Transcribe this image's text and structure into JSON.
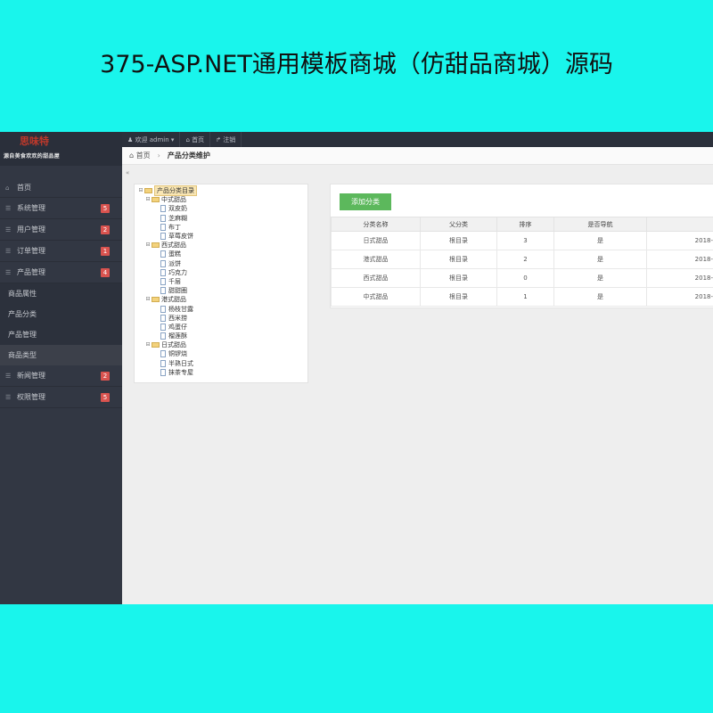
{
  "banner": {
    "title": "375-ASP.NET通用模板商城（仿甜品商城）源码"
  },
  "logo": {
    "name": "思味特",
    "slogan": "源自美食欢欢的甜品屋"
  },
  "topbar": {
    "welcome": "欢迎 admin",
    "home": "首页",
    "logout": "注销"
  },
  "sidebar": {
    "home": "首页",
    "items": [
      {
        "label": "系统管理",
        "badge": "5"
      },
      {
        "label": "用户管理",
        "badge": "2"
      },
      {
        "label": "订单管理",
        "badge": "1"
      },
      {
        "label": "产品管理",
        "badge": "4"
      }
    ],
    "subitems": [
      "商品属性",
      "产品分类",
      "产品管理",
      "商品类型"
    ],
    "items2": [
      {
        "label": "新闻管理",
        "badge": "2"
      },
      {
        "label": "权限管理",
        "badge": "5"
      }
    ]
  },
  "breadcrumb": {
    "home": "首页",
    "current": "产品分类维护"
  },
  "tree": {
    "root": "产品分类目录",
    "groups": [
      {
        "name": "中式甜品",
        "children": [
          "双皮奶",
          "芝麻糊",
          "布丁",
          "草莓皮饼"
        ]
      },
      {
        "name": "西式甜品",
        "children": [
          "蛋糕",
          "派饼",
          "巧克力",
          "千层",
          "甜甜圈"
        ]
      },
      {
        "name": "港式甜品",
        "children": [
          "杨枝甘露",
          "西米捞",
          "鸡蛋仔",
          "榴莲酥"
        ]
      },
      {
        "name": "日式甜品",
        "children": [
          "铜锣烧",
          "半熟日式",
          "抹茶专屋"
        ]
      }
    ]
  },
  "table": {
    "add_button": "添加分类",
    "headers": [
      "分类名称",
      "父分类",
      "排序",
      "是否导航",
      ""
    ],
    "rows": [
      [
        "日式甜品",
        "根目录",
        "3",
        "是",
        "2018-"
      ],
      [
        "港式甜品",
        "根目录",
        "2",
        "是",
        "2018-"
      ],
      [
        "西式甜品",
        "根目录",
        "0",
        "是",
        "2018-"
      ],
      [
        "中式甜品",
        "根目录",
        "1",
        "是",
        "2018-"
      ]
    ]
  }
}
